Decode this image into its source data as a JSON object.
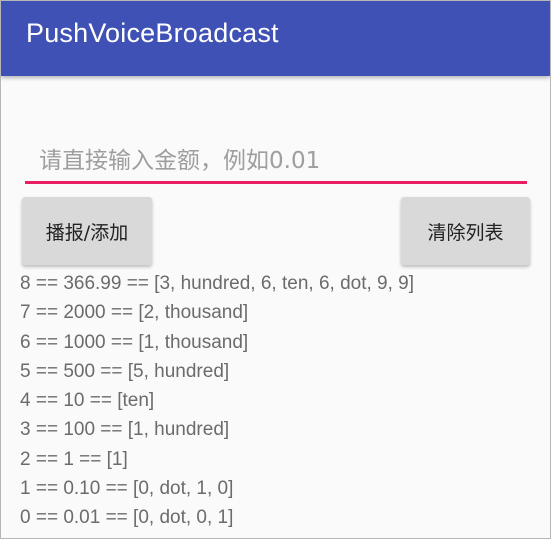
{
  "app_bar": {
    "title": "PushVoiceBroadcast",
    "color": "#3f51b5"
  },
  "amount_input": {
    "value": "",
    "placeholder": "请直接输入金额，例如0.01",
    "accent_color": "#e91e63"
  },
  "buttons": {
    "broadcast_label": "播报/添加",
    "clear_label": "清除列表"
  },
  "log": [
    "8 == 366.99 == [3, hundred, 6, ten, 6, dot, 9, 9]",
    "7 == 2000 == [2, thousand]",
    "6 == 1000 == [1, thousand]",
    "5 == 500 == [5, hundred]",
    "4 == 10 == [ten]",
    "3 == 100 == [1, hundred]",
    "2 == 1 == [1]",
    "1 == 0.10 == [0, dot, 1, 0]",
    "0 == 0.01 == [0, dot, 0, 1]"
  ]
}
